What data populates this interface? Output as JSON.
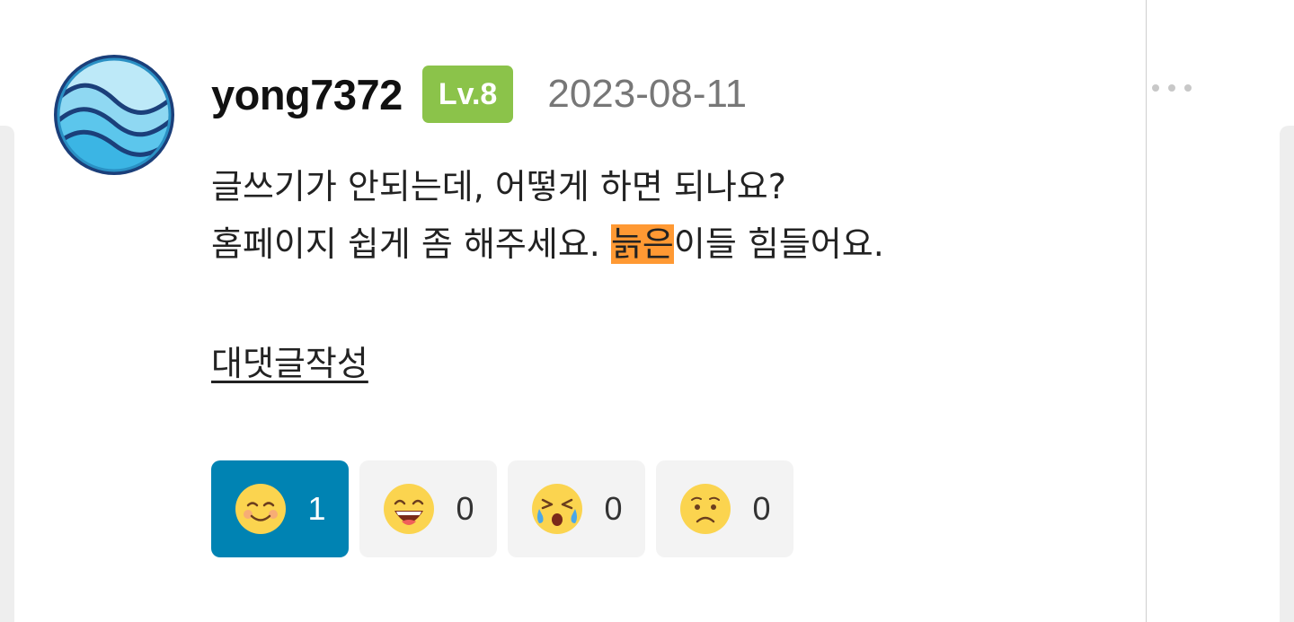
{
  "comment": {
    "username": "yong7372",
    "level": "Lv.8",
    "date": "2023-08-11",
    "body_line1": "글쓰기가 안되는데, 어떻게 하면 되나요?",
    "body_line2_before": "홈페이지 쉽게 좀 해주세요. ",
    "body_line2_highlight": "늙은",
    "body_line2_after": "이들 힘들어요.",
    "reply_link": "대댓글작성",
    "avatar_icon": "wave-icon",
    "more_icon": "more-dots-icon"
  },
  "reactions": [
    {
      "icon": "smile-emoji-icon",
      "count": "1",
      "active": true
    },
    {
      "icon": "laugh-emoji-icon",
      "count": "0",
      "active": false
    },
    {
      "icon": "crying-emoji-icon",
      "count": "0",
      "active": false
    },
    {
      "icon": "sad-emoji-icon",
      "count": "0",
      "active": false
    }
  ],
  "colors": {
    "level_badge": "#8bc34a",
    "highlight": "#ff9933",
    "active_reaction": "#0083b3",
    "inactive_reaction": "#f3f3f3"
  }
}
